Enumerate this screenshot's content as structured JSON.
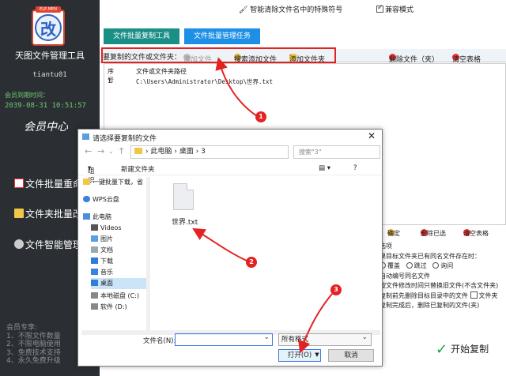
{
  "sidebar": {
    "logo_badge": "ELE.MEN",
    "logo_char": "改",
    "app_name": "天图文件管理工具",
    "username": "tiantu01",
    "member_expiry_label": "会员到期时间：",
    "member_expiry_date": "2039-08-31 10:51:57",
    "member_center": "会员中心",
    "nav": [
      {
        "label": "文件批量重命名"
      },
      {
        "label": "文件夹批量改名"
      },
      {
        "label": "文件智能管理"
      }
    ],
    "perks": [
      "会员专享:",
      "1、不限文件数量",
      "2、不限电脑使用",
      "3、免费技术支持",
      "4、永久免费升级"
    ]
  },
  "topbar": {
    "smart_clear_label": "智能清除文件名中的特殊符号",
    "compat_mode_label": "兼容模式",
    "compat_mode_checked": true
  },
  "tabs": [
    {
      "label": "文件批量复制工具"
    },
    {
      "label": "文件批量管理任务"
    }
  ],
  "toolbar": {
    "title": "要复制的文件或文件夹：",
    "add_file": "添加文件",
    "search_add_file": "搜索添加文件",
    "add_folder": "添加文件夹",
    "delete_file": "删除文件（夹）",
    "clear_table": "清空表格"
  },
  "table": {
    "headers": [
      "序号",
      "文件或文件夹路径"
    ],
    "rows": [
      {
        "index": "1",
        "path": "C:\\Users\\Administrator\\Desktop\\世界.txt"
      }
    ]
  },
  "target_buttons": {
    "confirm": "确定",
    "delete_selected": "删除已选",
    "clear_table": "清空表格"
  },
  "options": {
    "title": "选项",
    "same_name_question": "果目标文件夹已有同名文件存在时：",
    "radio_overwrite": "覆盖",
    "radio_skip": "跳过",
    "radio_ask": "询问",
    "auto_number": "自动编号同名文件",
    "replace_old": "按文件修改时间只替换旧文件(不含文件夹)",
    "delete_before": "复制前先删除目标目录中的文件",
    "file_type": "文件夹",
    "delete_after": "复制完成后，删除已复制的文件(夹)"
  },
  "start_button": "开始复制",
  "dialog": {
    "title": "请选择要复制的文件",
    "address": [
      "此电脑",
      "桌面",
      "3"
    ],
    "search_placeholder": "搜索\"3\"",
    "organize": "组织",
    "new_folder": "新建文件夹",
    "nav_items": [
      {
        "label": "一键批量下载，省"
      },
      {
        "label": "WPS云盘"
      },
      {
        "label": "此电脑"
      },
      {
        "label": "Videos"
      },
      {
        "label": "图片"
      },
      {
        "label": "文档"
      },
      {
        "label": "下载"
      },
      {
        "label": "音乐"
      },
      {
        "label": "桌面"
      },
      {
        "label": "本地磁盘 (C:)"
      },
      {
        "label": "软件 (D:)"
      }
    ],
    "file_name": "世界.txt",
    "filename_label": "文件名(N):",
    "filename_value": "",
    "filetype_value": "所有格式",
    "open_button": "打开(O)",
    "cancel_button": "取消"
  },
  "annotations": [
    "1",
    "2",
    "3"
  ],
  "colors": {
    "sidebar_bg": "#2b2f33",
    "tab1": "#1a8f86",
    "tab2": "#1d8fe6",
    "annotation_red": "#e52222",
    "member_green": "#6ec86e"
  }
}
